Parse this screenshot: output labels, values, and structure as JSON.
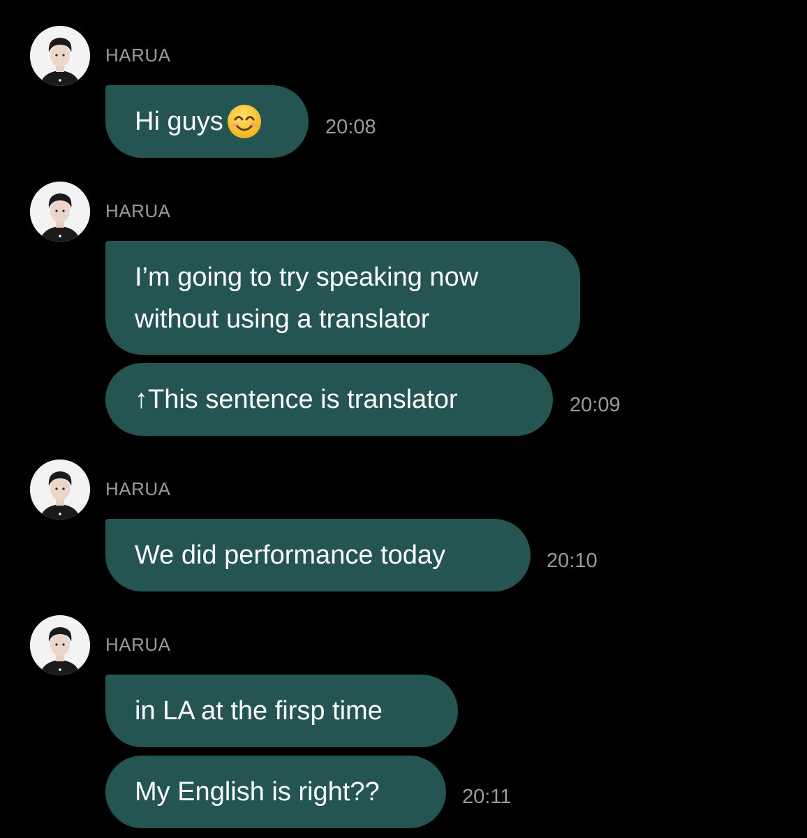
{
  "colors": {
    "background": "#000000",
    "bubble": "#255553",
    "meta_text": "#9b9b9b",
    "message_text": "#ffffff"
  },
  "messages": [
    {
      "sender": "HARUA",
      "avatar_icon": "profile-photo",
      "bubbles": [
        {
          "text": "Hi guys",
          "emoji": "smiling-face-with-smiling-eyes-icon"
        }
      ],
      "time": "20:08"
    },
    {
      "sender": "HARUA",
      "avatar_icon": "profile-photo",
      "bubbles": [
        {
          "line1": "I’m going to try speaking now",
          "line2": "without using a translator"
        },
        {
          "text": "↑This sentence is translator"
        }
      ],
      "time": "20:09"
    },
    {
      "sender": "HARUA",
      "avatar_icon": "profile-photo",
      "bubbles": [
        {
          "text": "We did performance today"
        }
      ],
      "time": "20:10"
    },
    {
      "sender": "HARUA",
      "avatar_icon": "profile-photo",
      "bubbles": [
        {
          "text": "in LA at the firsp time"
        },
        {
          "text": "My English is right??"
        }
      ],
      "time": "20:11"
    }
  ]
}
